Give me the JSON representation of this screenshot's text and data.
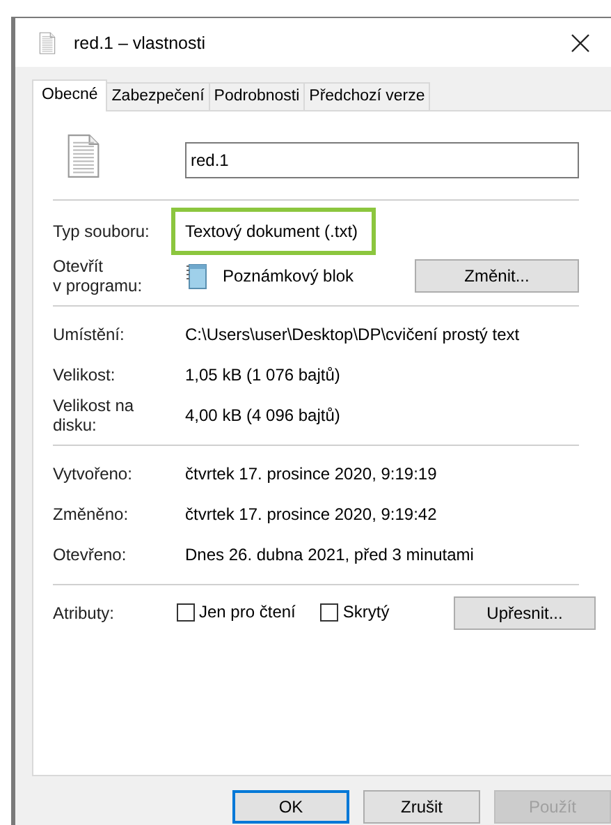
{
  "window": {
    "title": "red.1 – vlastnosti"
  },
  "tabs": [
    {
      "label": "Obecné",
      "selected": true
    },
    {
      "label": "Zabezpečení",
      "selected": false
    },
    {
      "label": "Podrobnosti",
      "selected": false
    },
    {
      "label": "Předchozí verze",
      "selected": false
    }
  ],
  "file_name": {
    "value": "red.1"
  },
  "sections": [
    {
      "rows": [
        {
          "kind": "text",
          "label": "Typ souboru:",
          "value": "Textový dokument (.txt)",
          "highlighted": true
        },
        {
          "kind": "program",
          "label": "Otevřít\nv programu:",
          "value": "Poznámkový blok",
          "button": "Změnit..."
        }
      ]
    },
    {
      "rows": [
        {
          "kind": "text",
          "label": "Umístění:",
          "value": "C:\\Users\\user\\Desktop\\DP\\cvičení prostý text",
          "highlighted": false
        },
        {
          "kind": "text",
          "label": "Velikost:",
          "value": "1,05 kB (1 076 bajtů)",
          "highlighted": false
        },
        {
          "kind": "text",
          "label": "Velikost na\ndisku:",
          "value": "4,00 kB (4 096 bajtů)",
          "highlighted": false
        }
      ]
    },
    {
      "rows": [
        {
          "kind": "text",
          "label": "Vytvořeno:",
          "value": "čtvrtek 17. prosince 2020, 9:19:19",
          "highlighted": false
        },
        {
          "kind": "text",
          "label": "Změněno:",
          "value": "čtvrtek 17. prosince 2020, 9:19:42",
          "highlighted": false
        },
        {
          "kind": "text",
          "label": "Otevřeno:",
          "value": "Dnes 26. dubna 2021, před 3 minutami",
          "highlighted": false
        }
      ]
    },
    {
      "rows": [
        {
          "kind": "attributes",
          "label": "Atributy:",
          "checkboxes": [
            {
              "label": "Jen pro čtení",
              "checked": false
            },
            {
              "label": "Skrytý",
              "checked": false
            }
          ],
          "button": "Upřesnit..."
        }
      ]
    }
  ],
  "buttons": [
    {
      "label": "OK",
      "default": true,
      "disabled": false
    },
    {
      "label": "Zrušit",
      "default": false,
      "disabled": false
    },
    {
      "label": "Použít",
      "default": false,
      "disabled": true
    }
  ]
}
